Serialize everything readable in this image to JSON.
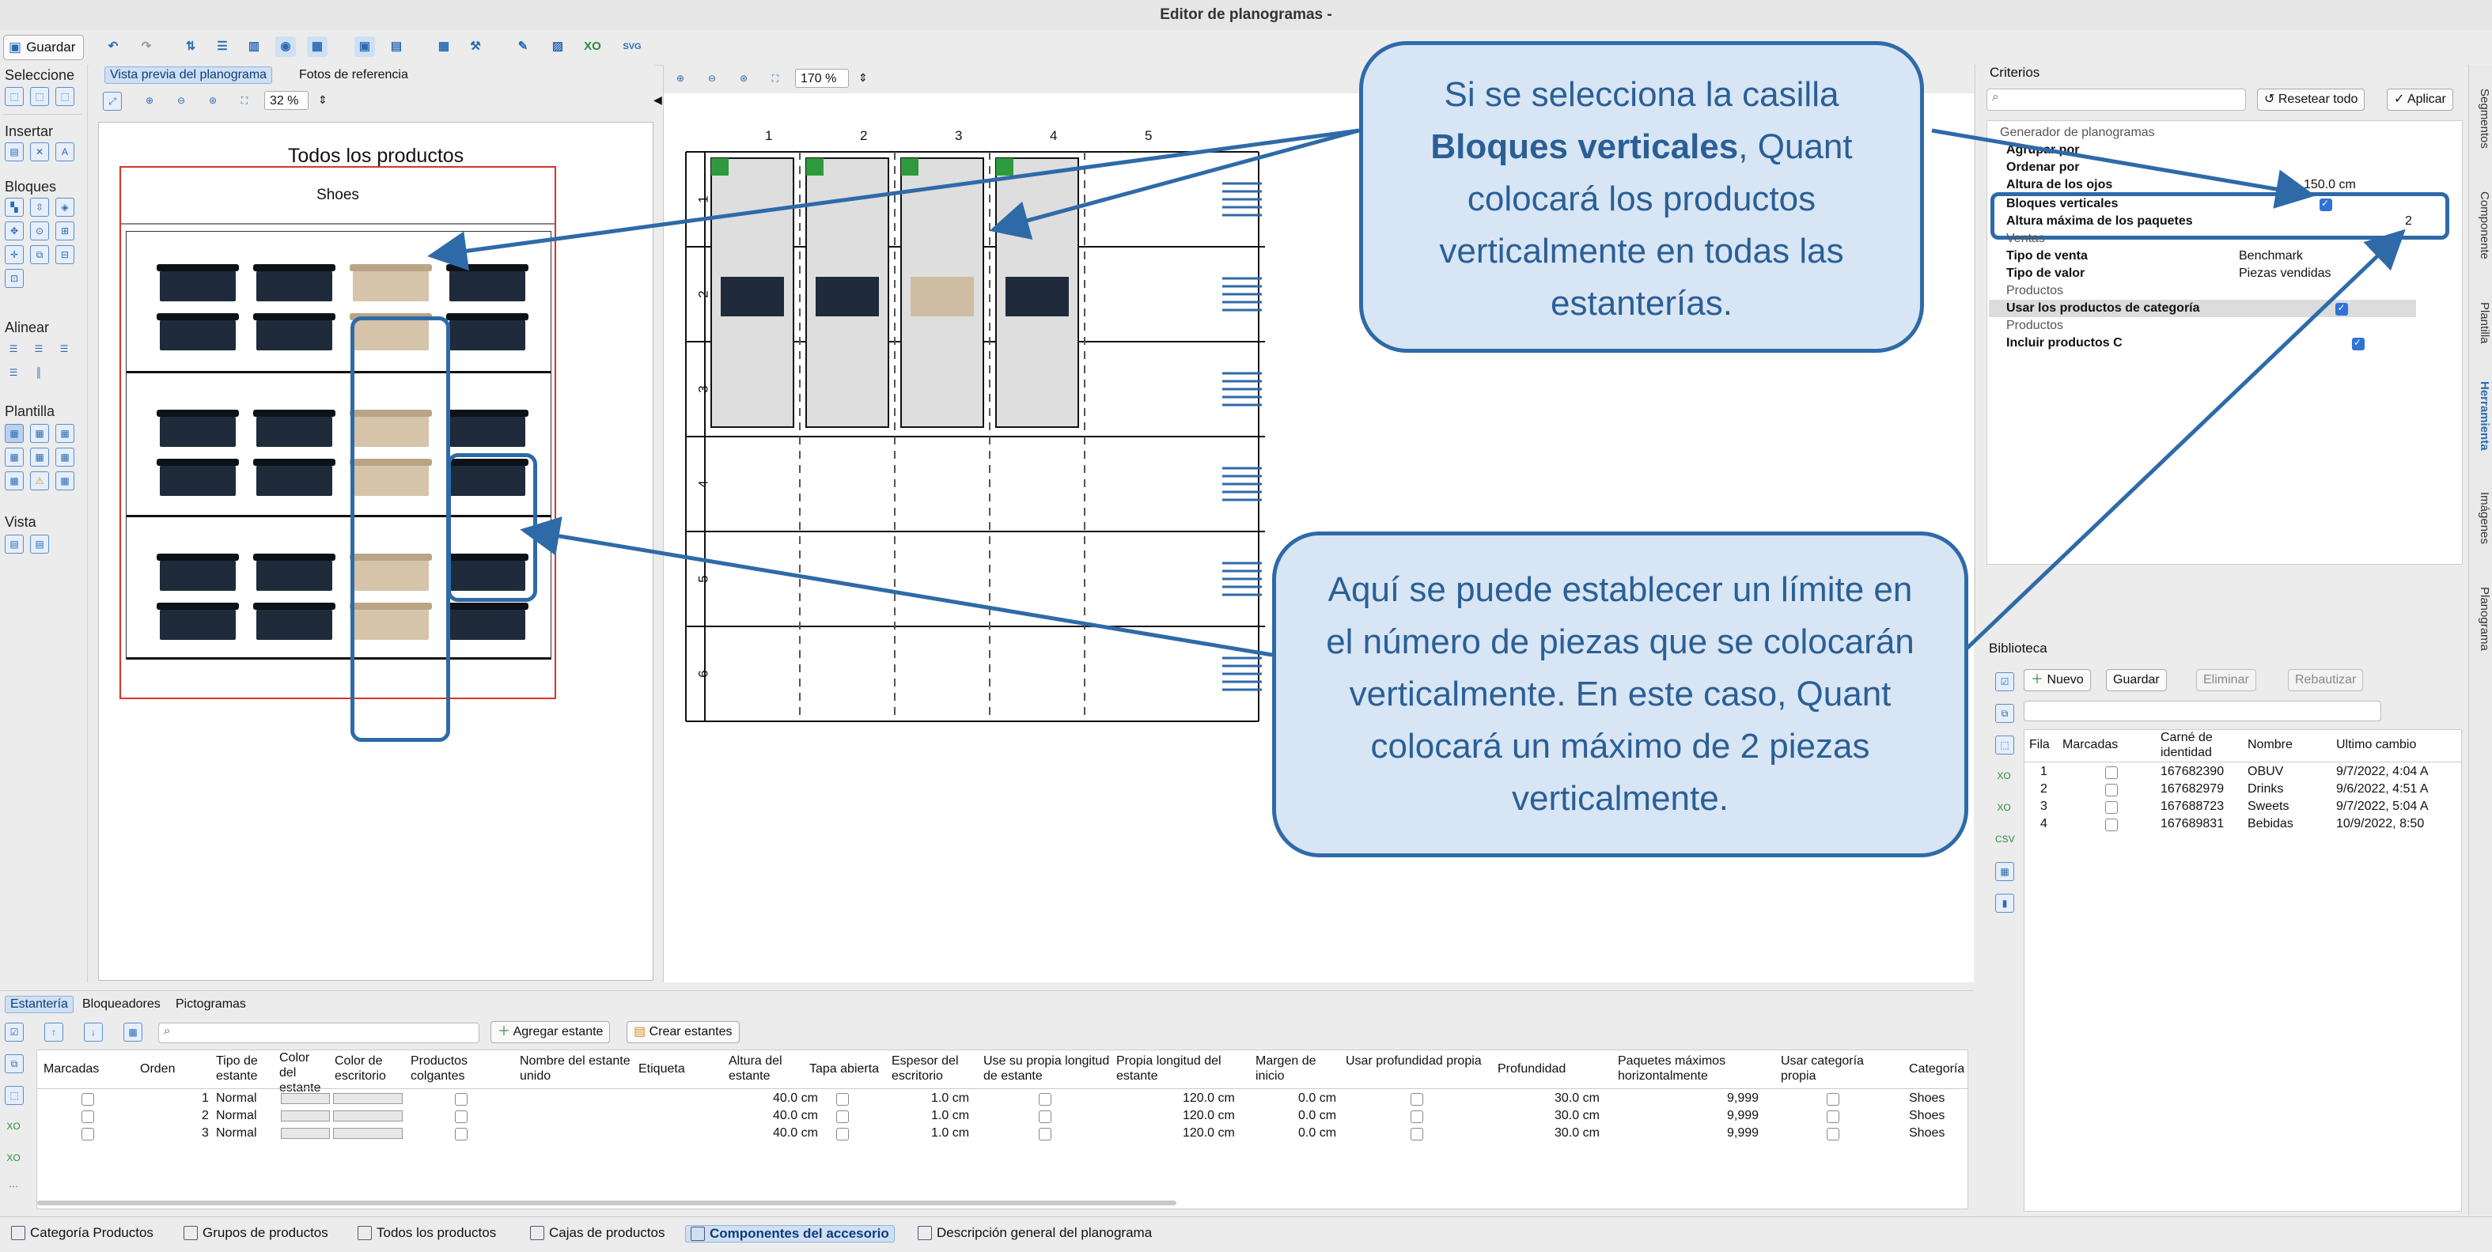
{
  "window": {
    "title": "Editor de planogramas -"
  },
  "toolbar": {
    "save_label": "Guardar"
  },
  "left_panel": {
    "sections": [
      "Seleccione",
      "Insertar",
      "Bloques",
      "Alinear",
      "Plantilla",
      "Vista"
    ]
  },
  "preview": {
    "tabs": [
      "Vista previa del planograma",
      "Fotos de referencia"
    ],
    "zoom": "32 %",
    "title": "Todos los productos",
    "category": "Shoes"
  },
  "grid": {
    "zoom": "170 %",
    "columns": [
      "1",
      "2",
      "3",
      "4",
      "5"
    ],
    "rows": [
      "1",
      "2",
      "3",
      "4",
      "5",
      "6"
    ]
  },
  "callouts": {
    "top_parts": [
      "Si se selecciona la casilla",
      "Bloques verticales",
      ", Quant colocará los productos verticalmente en todas las estanterías."
    ],
    "bottom": "Aquí se puede establecer un límite en el número de piezas que se colocarán verticalmente. En este caso, Quant colocará un máximo de 2 piezas verticalmente."
  },
  "criteria": {
    "title": "Criterios",
    "reset_label": "Resetear todo",
    "apply_label": "Aplicar",
    "rows": [
      {
        "label": "Generador de planogramas",
        "value": "",
        "type": "group"
      },
      {
        "label": "Agrupar por",
        "value": "",
        "type": "item"
      },
      {
        "label": "Ordenar por",
        "value": "",
        "type": "item"
      },
      {
        "label": "Altura de los ojos",
        "value": "150.0 cm",
        "type": "item"
      },
      {
        "label": "Bloques verticales",
        "value": "",
        "type": "check"
      },
      {
        "label": "Altura máxima de los paquetes",
        "value": "2",
        "type": "item"
      },
      {
        "label": "Ventas",
        "value": "",
        "type": "group"
      },
      {
        "label": "Tipo de venta",
        "value": "Benchmark",
        "type": "item"
      },
      {
        "label": "Tipo de valor",
        "value": "Piezas vendidas",
        "type": "item"
      },
      {
        "label": "Productos",
        "value": "",
        "type": "group"
      },
      {
        "label": "Usar los productos de categoría",
        "value": "",
        "type": "check"
      },
      {
        "label": "Productos",
        "value": "",
        "type": "group"
      },
      {
        "label": "Incluir productos C",
        "value": "",
        "type": "check"
      }
    ]
  },
  "library": {
    "title": "Biblioteca",
    "new_label": "Nuevo",
    "save_label": "Guardar",
    "delete_label": "Eliminar",
    "rebuild_label": "Rebautizar",
    "headers": [
      "Fila",
      "Marcadas",
      "Carné de identidad",
      "Nombre",
      "Ultimo cambio"
    ],
    "rows": [
      [
        "1",
        "",
        "167682390",
        "OBUV",
        "9/7/2022, 4:04 A"
      ],
      [
        "2",
        "",
        "167682979",
        "Drinks",
        "9/6/2022, 4:51 A"
      ],
      [
        "3",
        "",
        "167688723",
        "Sweets",
        "9/7/2022, 5:04 A"
      ],
      [
        "4",
        "",
        "167689831",
        "Bebidas",
        "10/9/2022, 8:50"
      ]
    ]
  },
  "shelf_table": {
    "tabs": [
      "Estantería",
      "Bloqueadores",
      "Pictogramas"
    ],
    "add_label": "Agregar estante",
    "create_label": "Crear estantes",
    "headers": [
      "Marcadas",
      "Orden",
      "Tipo de estante",
      "Color del estante",
      "Color de escritorio",
      "Productos colgantes",
      "Nombre del estante unido",
      "Etiqueta",
      "Altura del estante",
      "Tapa abierta",
      "Espesor del escritorio",
      "Use su propia longitud de estante",
      "Propia longitud del estante",
      "Margen de inicio",
      "Usar profundidad propia",
      "Profundidad",
      "Paquetes máximos horizontalmente",
      "Usar categoría propia",
      "Categoría"
    ],
    "rows": [
      {
        "orden": "1",
        "tipo": "Normal",
        "altura": "40.0 cm",
        "espesor": "1.0 cm",
        "longitud": "120.0 cm",
        "margen": "0.0 cm",
        "profundidad": "30.0 cm",
        "paquetes": "9,999",
        "categoria": "Shoes"
      },
      {
        "orden": "2",
        "tipo": "Normal",
        "altura": "40.0 cm",
        "espesor": "1.0 cm",
        "longitud": "120.0 cm",
        "margen": "0.0 cm",
        "profundidad": "30.0 cm",
        "paquetes": "9,999",
        "categoria": "Shoes"
      },
      {
        "orden": "3",
        "tipo": "Normal",
        "altura": "40.0 cm",
        "espesor": "1.0 cm",
        "longitud": "120.0 cm",
        "margen": "0.0 cm",
        "profundidad": "30.0 cm",
        "paquetes": "9,999",
        "categoria": "Shoes"
      }
    ]
  },
  "bottom_tabs": [
    "Categoría Productos",
    "Grupos de productos",
    "Todos los productos",
    "Cajas de productos",
    "Componentes del accesorio",
    "Descripción general del planograma"
  ],
  "right_sidebar": [
    "Segmentos",
    "Componente",
    "Plantilla",
    "Herramienta",
    "Imágenes",
    "Planograma"
  ],
  "colors": {
    "accent": "#2f6aa8",
    "callout_bg": "#d8e5f4",
    "planogram_border": "#d9332b"
  }
}
